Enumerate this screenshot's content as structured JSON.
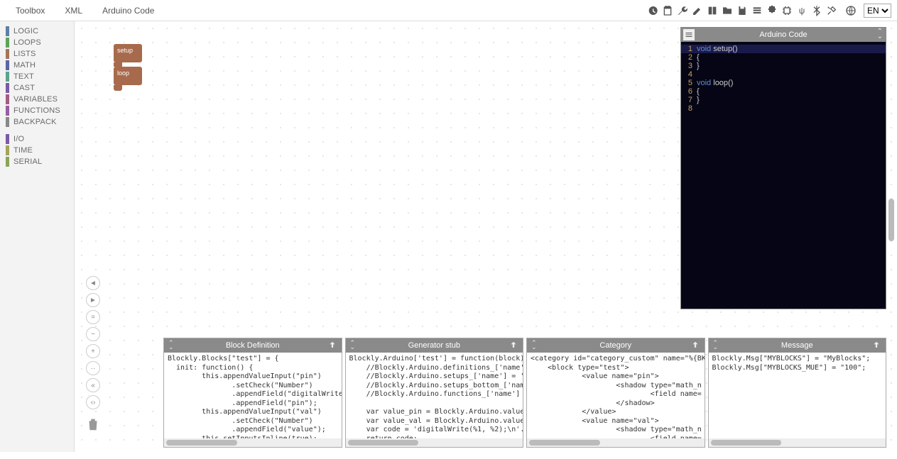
{
  "menu": {
    "items": [
      "Toolbox",
      "XML",
      "Arduino Code"
    ]
  },
  "toolbar_icons": [
    "history",
    "clipboard",
    "wrench",
    "pencil",
    "book",
    "folder",
    "save",
    "list",
    "puzzle",
    "chip",
    "psi",
    "bluetooth",
    "tools",
    "globe"
  ],
  "lang": {
    "value": "EN",
    "options": [
      "EN"
    ]
  },
  "sidebar": {
    "groups": [
      [
        {
          "label": "LOGIC",
          "color": "#5b80a5"
        },
        {
          "label": "LOOPS",
          "color": "#5ba55b"
        },
        {
          "label": "LISTS",
          "color": "#a5745b"
        },
        {
          "label": "MATH",
          "color": "#5b67a5"
        },
        {
          "label": "TEXT",
          "color": "#5ba58c"
        },
        {
          "label": "CAST",
          "color": "#7a5ba5"
        },
        {
          "label": "VARIABLES",
          "color": "#a55b80"
        },
        {
          "label": "FUNCTIONS",
          "color": "#995ba5"
        },
        {
          "label": "BACKPACK",
          "color": "#888"
        }
      ],
      [
        {
          "label": "I/O",
          "color": "#7a5ba5"
        },
        {
          "label": "TIME",
          "color": "#a5a55b"
        },
        {
          "label": "SERIAL",
          "color": "#8aa55b"
        }
      ]
    ]
  },
  "block": {
    "top_label": "setup",
    "bot_label": "loop"
  },
  "code_panel": {
    "title": "Arduino Code",
    "lines": [
      {
        "n": "1",
        "kw": "void",
        "rest": " setup()",
        "hl": true
      },
      {
        "n": "2",
        "kw": "",
        "rest": "{"
      },
      {
        "n": "3",
        "kw": "",
        "rest": "}"
      },
      {
        "n": "4",
        "kw": "",
        "rest": ""
      },
      {
        "n": "5",
        "kw": "void",
        "rest": " loop()"
      },
      {
        "n": "6",
        "kw": "",
        "rest": "{"
      },
      {
        "n": "7",
        "kw": "",
        "rest": "}"
      },
      {
        "n": "8",
        "kw": "",
        "rest": ""
      }
    ]
  },
  "ws_controls": [
    "◄",
    "►",
    "=",
    "−",
    "+",
    "··",
    "«",
    "‹›"
  ],
  "bottom": [
    {
      "title": "Block Definition",
      "code": "Blockly.Blocks[\"test\"] = {\n  init: function() {\n        this.appendValueInput(\"pin\")\n               .setCheck(\"Number\")\n               .appendField(\"digitalWrite\")\n               .appendField(\"pin\");\n        this.appendValueInput(\"val\")\n               .setCheck(\"Number\")\n               .appendField(\"value\");\n        this.setInputsInline(true);\n        this.setPreviousStatement(true, null);\n        this.setNextStatement(true, null);"
    },
    {
      "title": "Generator stub",
      "code": "Blockly.Arduino['test'] = function(block) {\n    //Blockly.Arduino.definitions_['name'] = '\n    //Blockly.Arduino.setups_['name'] = '//set\n    //Blockly.Arduino.setups_bottom_['name'] =\n    //Blockly.Arduino.functions_['name'] = 'St\n\n    var value_pin = Blockly.Arduino.valueToCod\n    var value_val = Blockly.Arduino.valueToCod\n    var code = 'digitalWrite(%1, %2);\\n'.repla\n    return code;"
    },
    {
      "title": "Category",
      "code": "<category id=\"category_custom\" name=\"%{BKY_M\n    <block type=\"test\">\n            <value name=\"pin\">\n                    <shadow type=\"math_n\n                            <field name=\n                    </shadow>\n            </value>\n            <value name=\"val\">\n                    <shadow type=\"math_n\n                            <field name=\n                    </shadow>\n            </value>"
    },
    {
      "title": "Message",
      "code": "Blockly.Msg[\"MYBLOCKS\"] = \"MyBlocks\";\nBlockly.Msg[\"MYBLOCKS_MUE\"] = \"100\";"
    }
  ]
}
